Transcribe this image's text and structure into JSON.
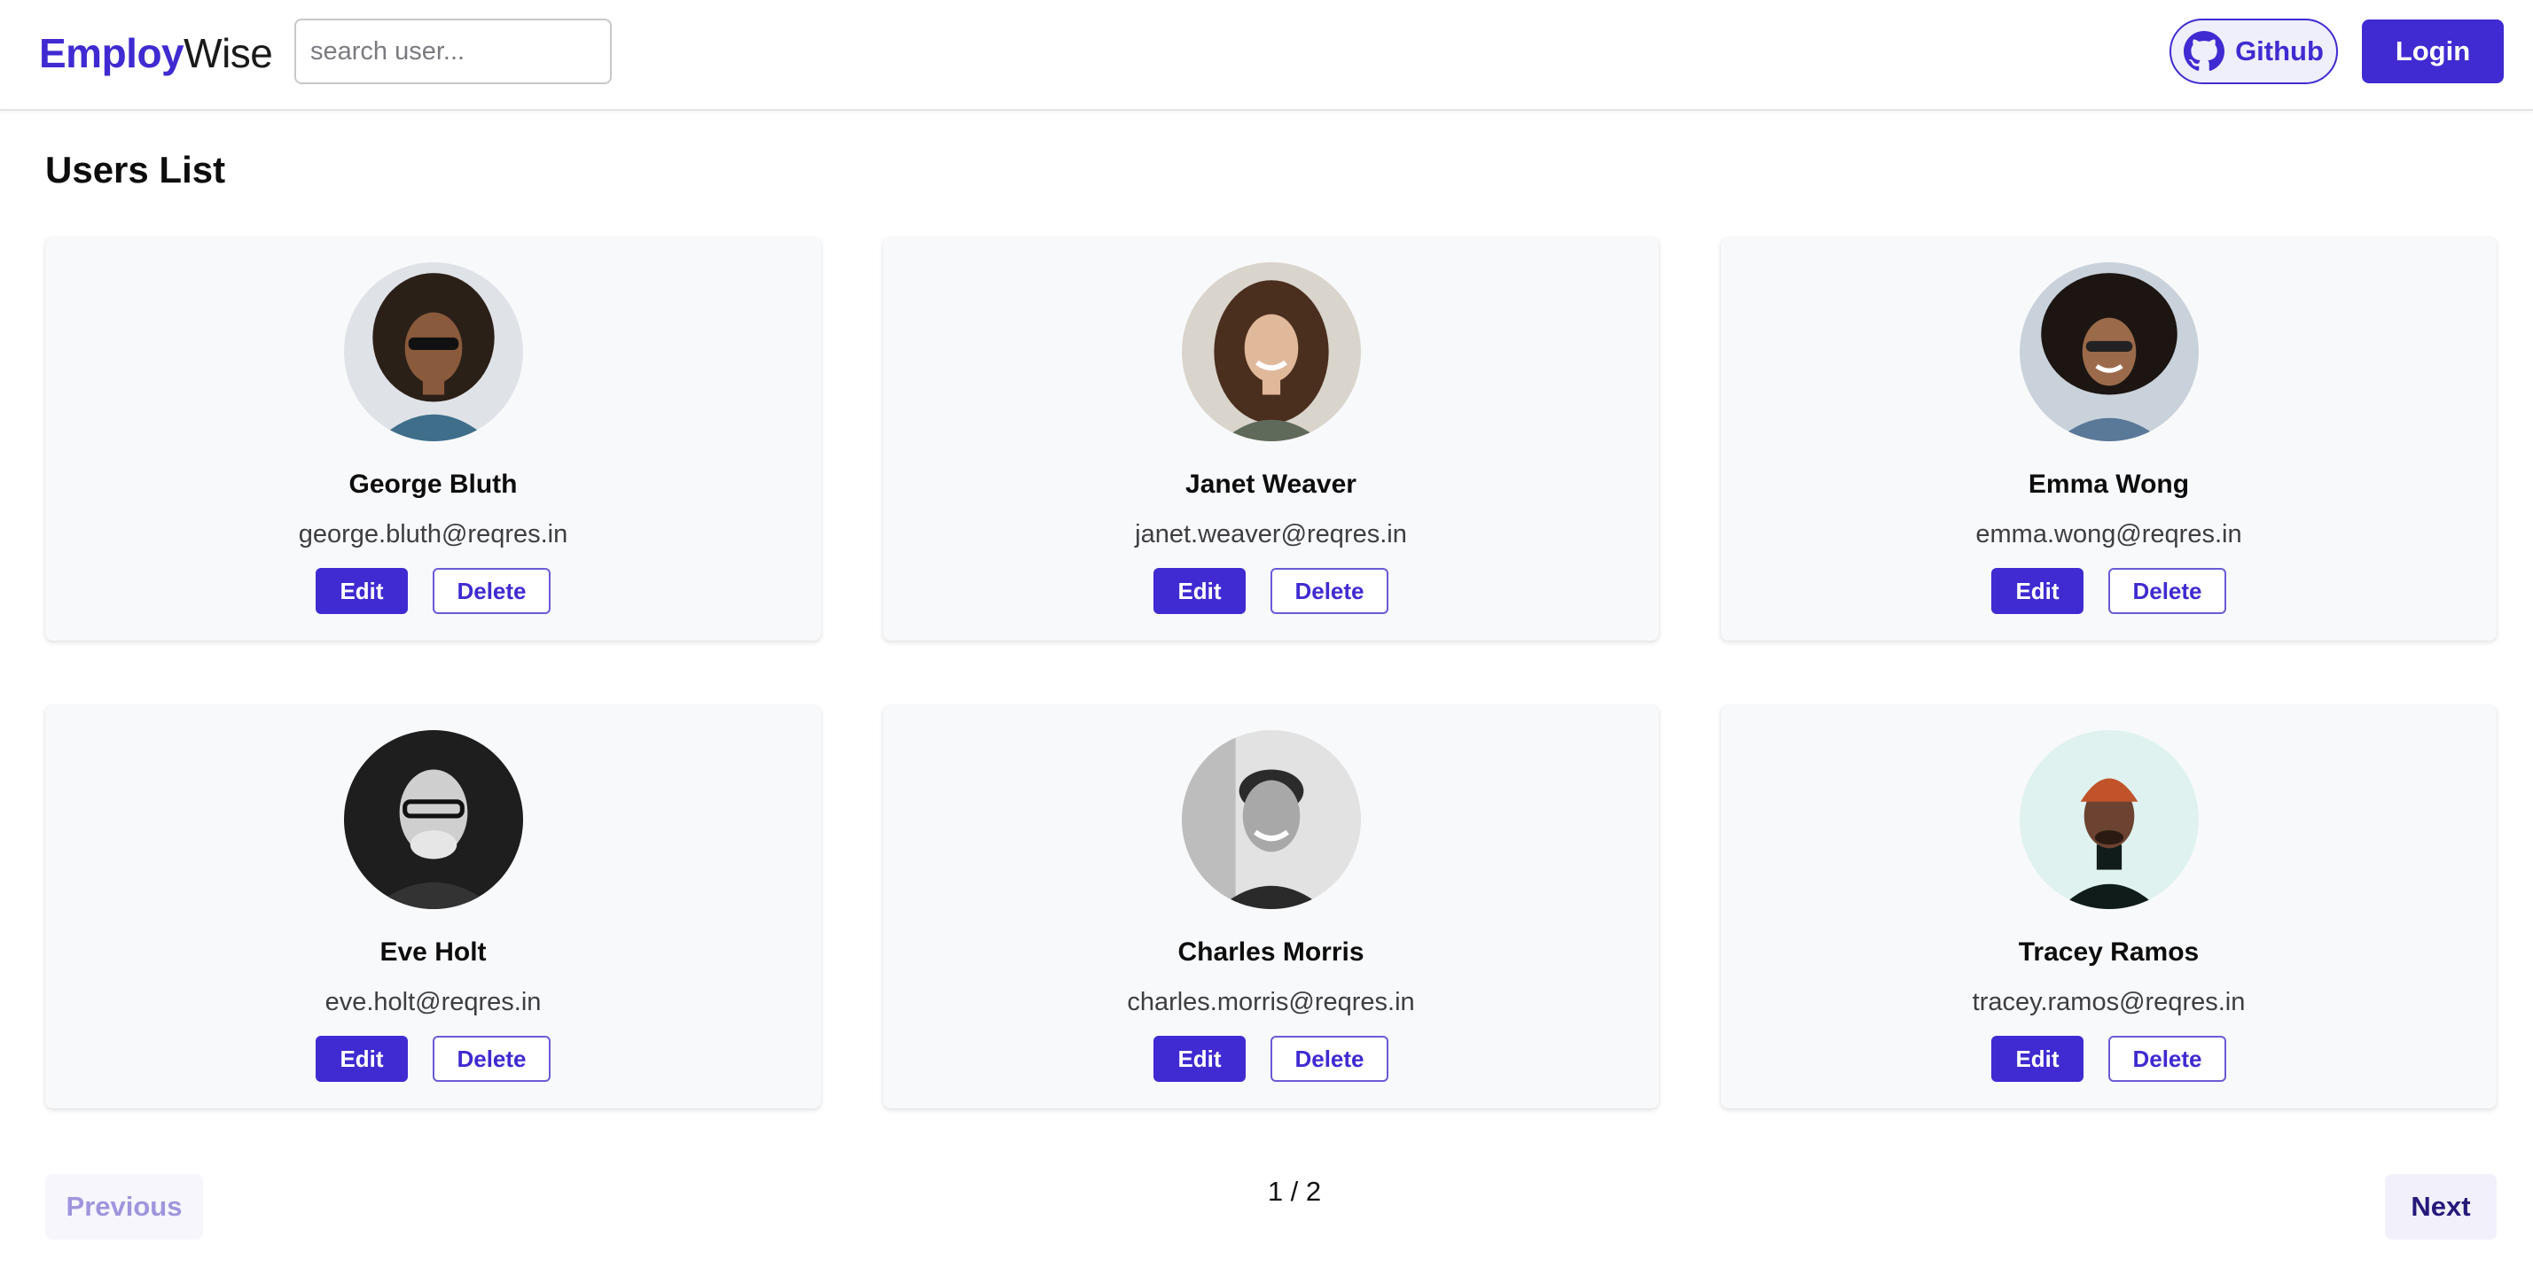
{
  "header": {
    "logo_part1": "Employ",
    "logo_part2": "Wise",
    "search_placeholder": "search user...",
    "github_label": "Github",
    "login_label": "Login"
  },
  "main": {
    "title": "Users List",
    "edit_label": "Edit",
    "delete_label": "Delete",
    "users": [
      {
        "name": "George Bluth",
        "email": "george.bluth@reqres.in"
      },
      {
        "name": "Janet Weaver",
        "email": "janet.weaver@reqres.in"
      },
      {
        "name": "Emma Wong",
        "email": "emma.wong@reqres.in"
      },
      {
        "name": "Eve Holt",
        "email": "eve.holt@reqres.in"
      },
      {
        "name": "Charles Morris",
        "email": "charles.morris@reqres.in"
      },
      {
        "name": "Tracey Ramos",
        "email": "tracey.ramos@reqres.in"
      }
    ]
  },
  "pagination": {
    "previous_label": "Previous",
    "page_indicator": "1 / 2",
    "next_label": "Next"
  },
  "colors": {
    "accent": "#3f2bd1",
    "card_bg": "#f8f9fb"
  }
}
